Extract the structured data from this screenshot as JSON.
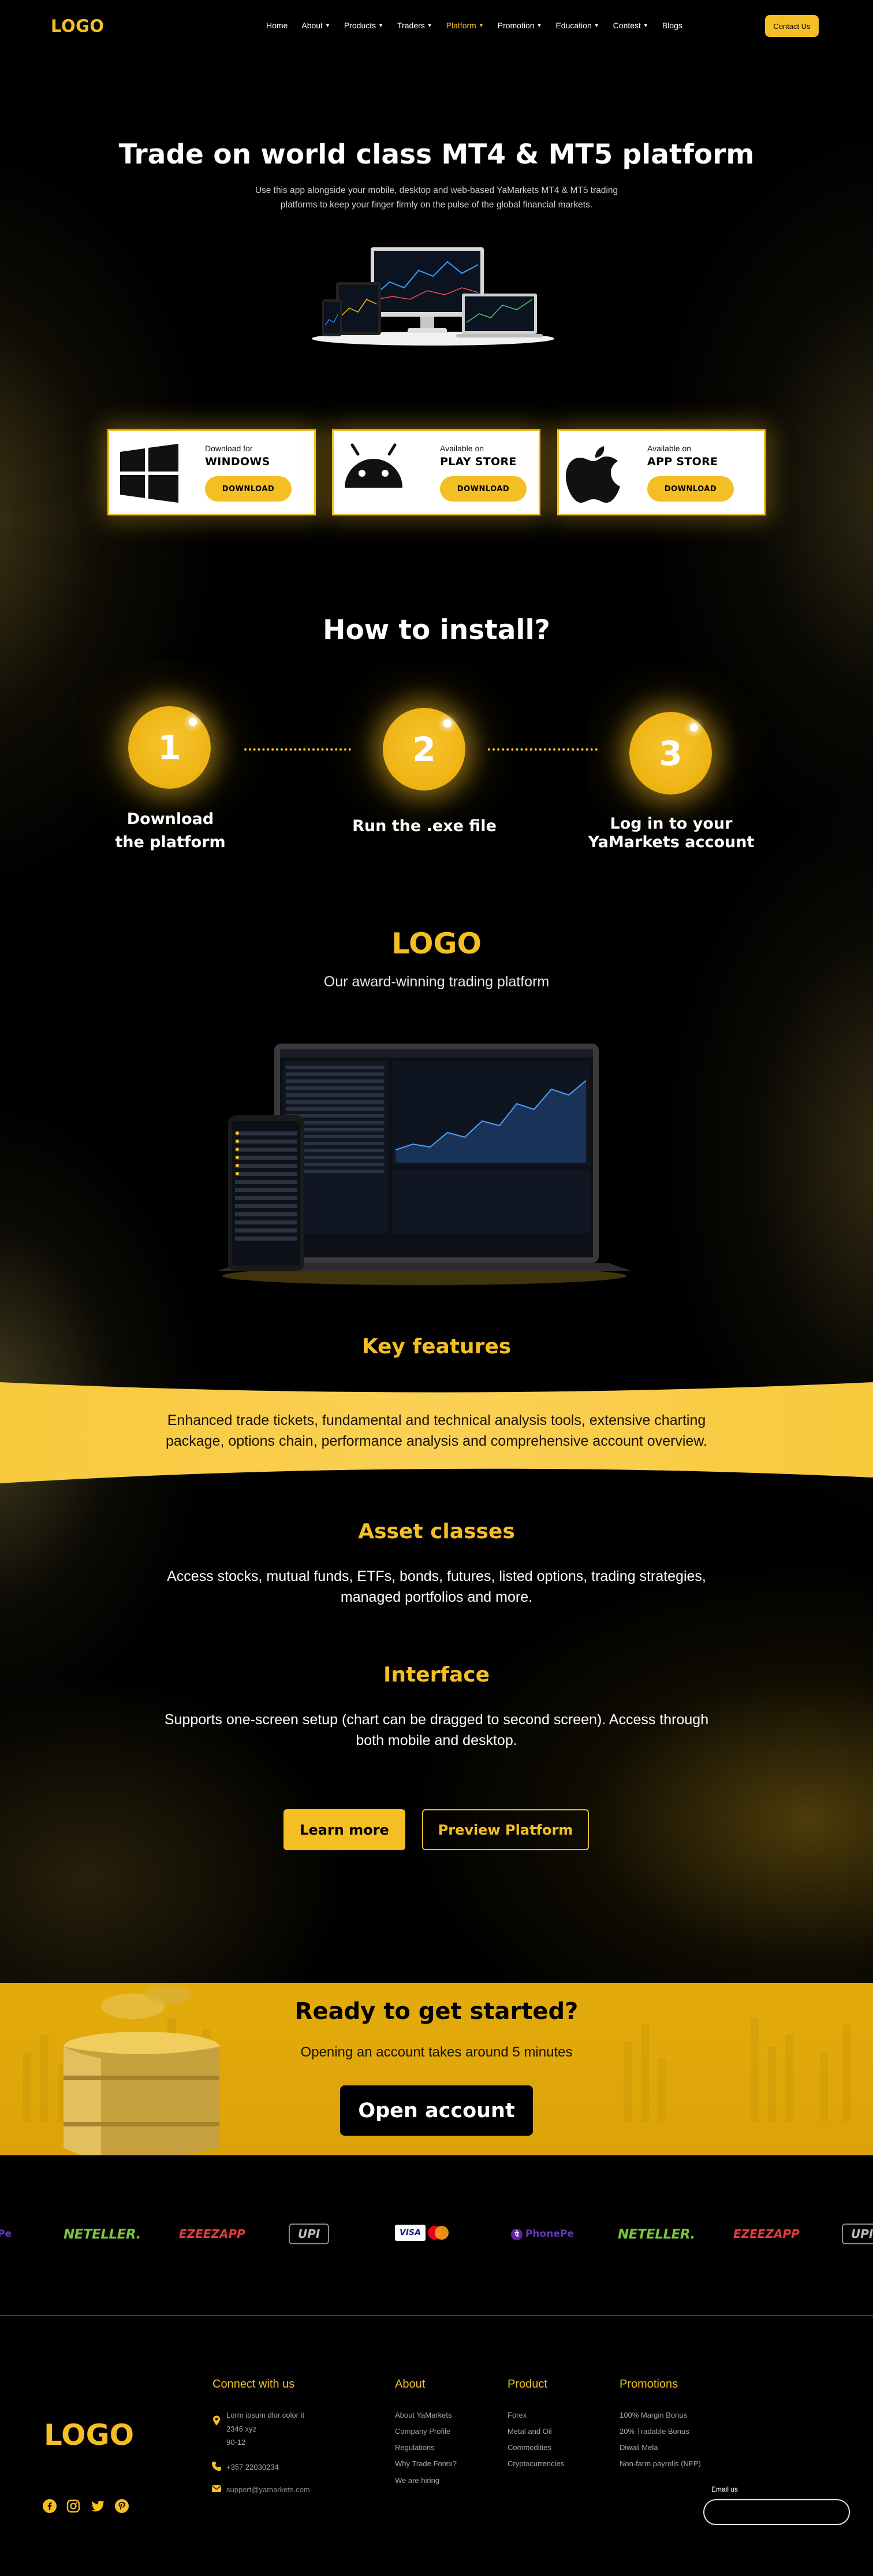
{
  "header": {
    "logo": "LOGO",
    "nav": [
      {
        "label": "Home",
        "dropdown": false,
        "active": false
      },
      {
        "label": "About",
        "dropdown": true,
        "active": false
      },
      {
        "label": "Products",
        "dropdown": true,
        "active": false
      },
      {
        "label": "Traders",
        "dropdown": true,
        "active": false
      },
      {
        "label": "Platform",
        "dropdown": true,
        "active": true
      },
      {
        "label": "Promotion",
        "dropdown": true,
        "active": false
      },
      {
        "label": "Education",
        "dropdown": true,
        "active": false
      },
      {
        "label": "Contest",
        "dropdown": true,
        "active": false
      },
      {
        "label": "Blogs",
        "dropdown": false,
        "active": false
      }
    ],
    "contact_label": "Contact Us"
  },
  "hero": {
    "title": "Trade on world class MT4 & MT5 platform",
    "desc_line1": "Use this app alongside your mobile, desktop and web-based YaMarkets MT4 & MT5 trading",
    "desc_line2": "platforms to keep your finger firmly on the pulse of the global financial markets."
  },
  "downloads": [
    {
      "small": "Download for",
      "name": "WINDOWS",
      "button": "DOWNLOAD",
      "icon": "windows-icon"
    },
    {
      "small": "Available on",
      "name": "PLAY STORE",
      "button": "DOWNLOAD",
      "icon": "android-icon"
    },
    {
      "small": "Available on",
      "name": "APP STORE",
      "button": "DOWNLOAD",
      "icon": "apple-icon"
    }
  ],
  "install": {
    "title": "How to install?",
    "steps": [
      {
        "num": "1",
        "line1": "Download",
        "line2": "the platform"
      },
      {
        "num": "2",
        "line1": "Run the .exe file",
        "line2": ""
      },
      {
        "num": "3",
        "line1": "Log in to your",
        "line2": "YaMarkets account"
      }
    ]
  },
  "platform": {
    "logo": "LOGO",
    "subtitle": "Our award-winning trading platform"
  },
  "features": {
    "key_title": "Key features",
    "key_line1": "Enhanced trade tickets, fundamental and technical analysis tools, extensive charting",
    "key_line2": "package, options chain, performance analysis and comprehensive account overview.",
    "asset_title": "Asset classes",
    "asset_line1": "Access stocks, mutual funds, ETFs, bonds, futures, listed options, trading strategies,",
    "asset_line2": "managed portfolios and more.",
    "interface_title": "Interface",
    "interface_line1": "Supports one-screen setup (chart can be dragged to second screen). Access through",
    "interface_line2": "both mobile and desktop.",
    "learn_more": "Learn more",
    "preview": "Preview Platform"
  },
  "cta": {
    "title": "Ready to get started?",
    "subtitle": "Opening an account takes around 5 minutes",
    "button": "Open account"
  },
  "payments": {
    "items": [
      {
        "kind": "phonepe",
        "label": "Pe"
      },
      {
        "kind": "neteller",
        "label": "NETELLER."
      },
      {
        "kind": "ezee",
        "label": "EZEEZAPP"
      },
      {
        "kind": "upi",
        "label": "UPI"
      },
      {
        "kind": "visa",
        "label": "VISA"
      },
      {
        "kind": "phonepe",
        "label": "PhonePe"
      },
      {
        "kind": "neteller",
        "label": "NETELLER."
      },
      {
        "kind": "ezee",
        "label": "EZEEZAPP"
      },
      {
        "kind": "upi",
        "label": "UPI"
      }
    ]
  },
  "footer": {
    "logo": "LOGO",
    "connect_title": "Connect with us",
    "address_line1": "Lorm ipsum dlor color it",
    "address_line2": "2346 xyz",
    "address_line3": "90-12",
    "phone": "+357 22030234",
    "email": "support@yamarkets.com",
    "about_title": "About",
    "about_links": [
      "About YaMarkets",
      "Company Profile",
      "Regulations",
      "Why Trade Forex?",
      "We are hiring"
    ],
    "product_title": "Product",
    "product_links": [
      "Forex",
      "Metal and Oil",
      "Commodities",
      "Cryptocurrencies"
    ],
    "promotions_title": "Promotions",
    "promotions_links": [
      "100% Margin Bonus",
      "20% Tradable Bonus",
      "Diwali Mela",
      "Non-farm payrolls (NFP)"
    ],
    "email_label": "Email us"
  },
  "colors": {
    "accent": "#f4bf24",
    "background": "#000000",
    "cta_background": "#e3ab0a"
  }
}
